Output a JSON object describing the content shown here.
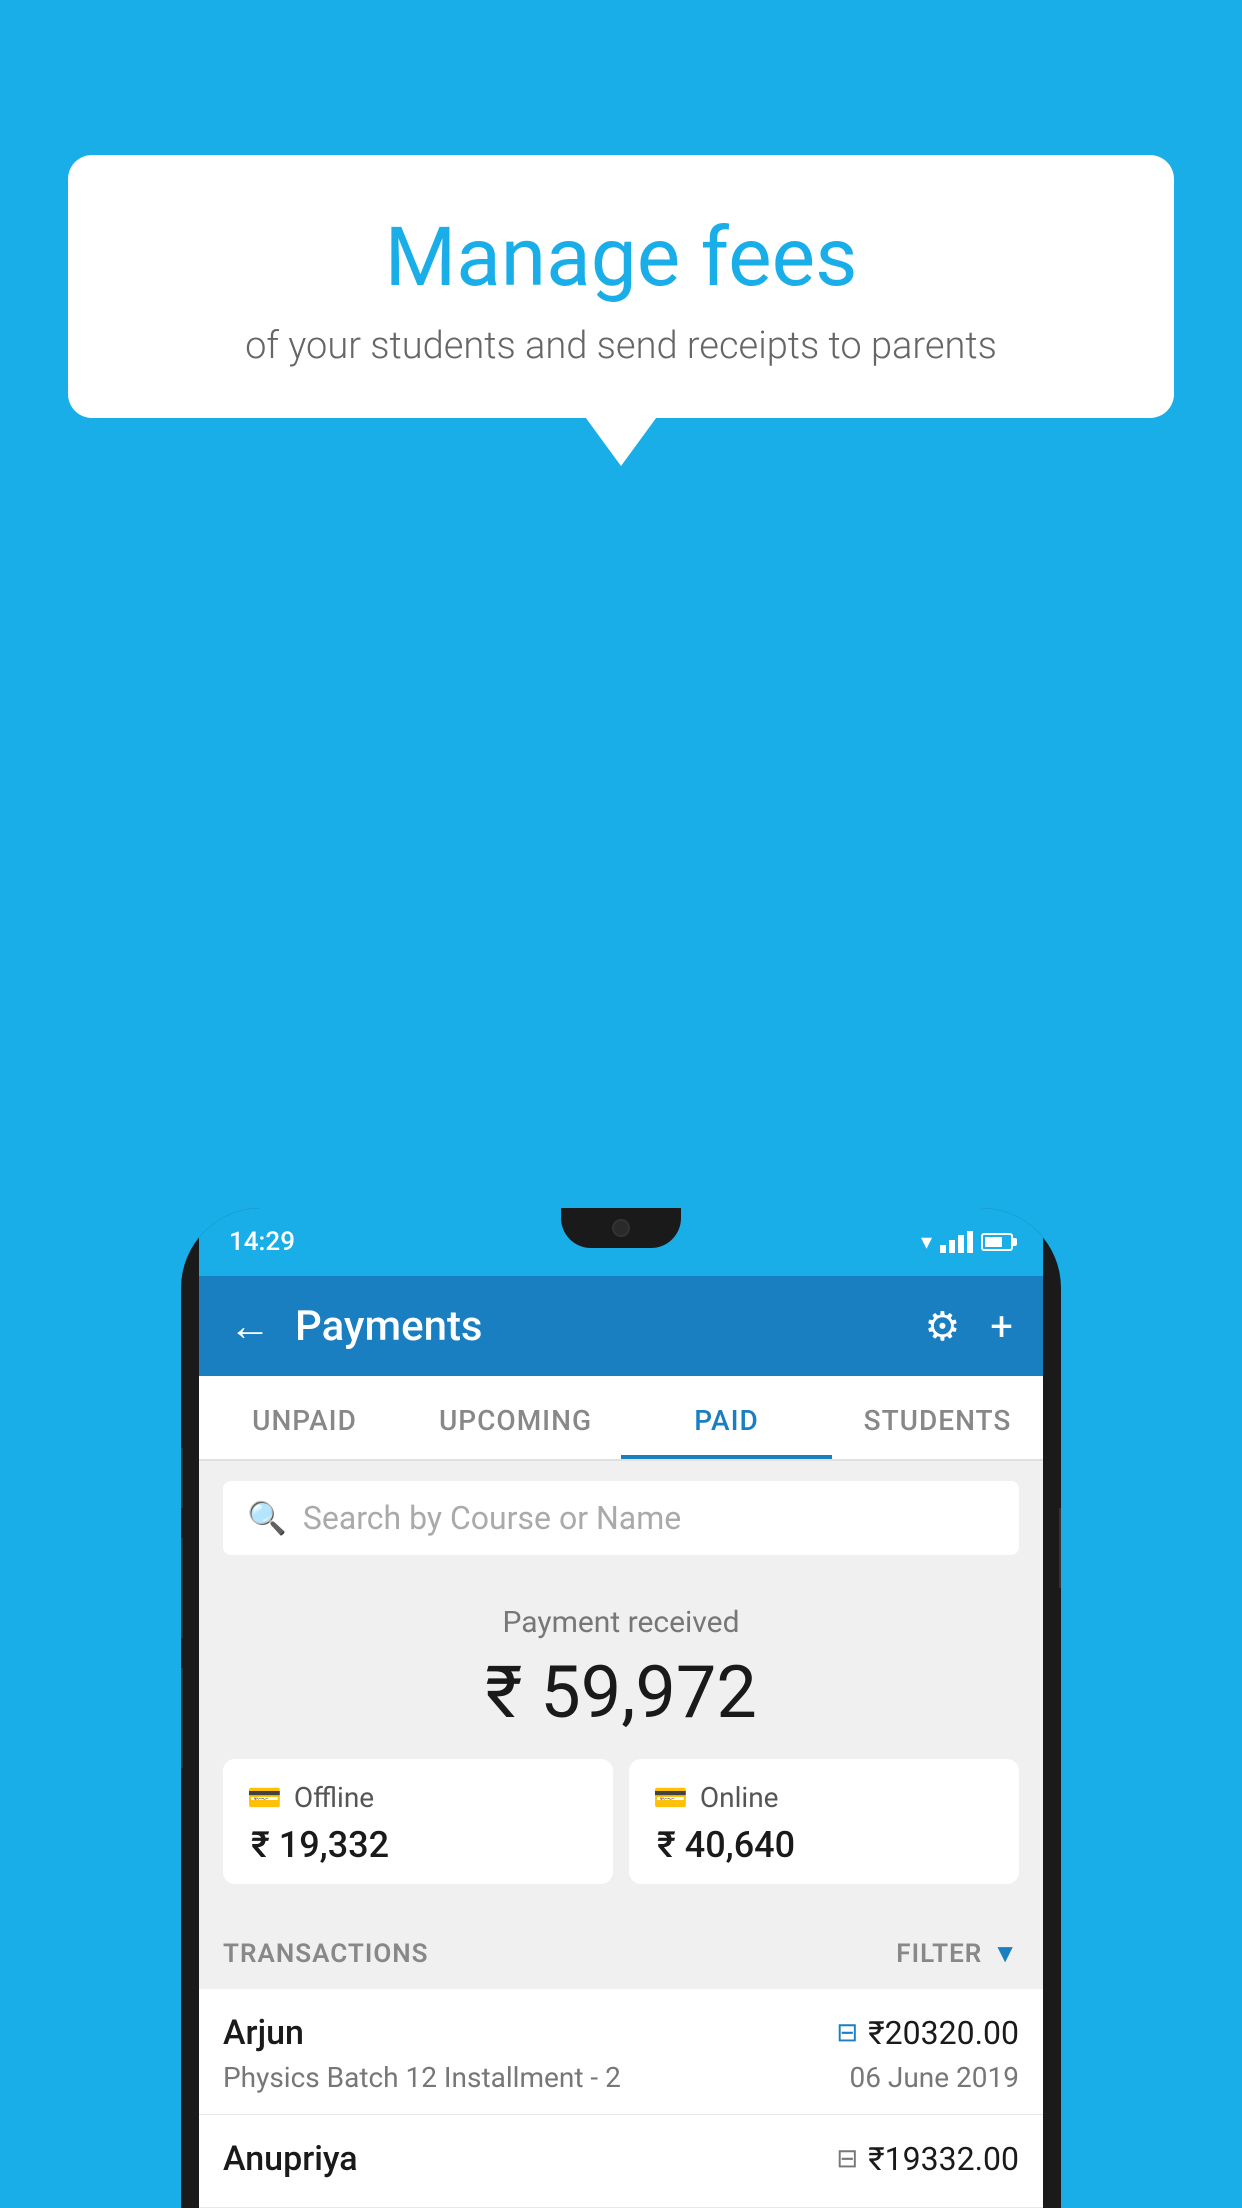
{
  "background_color": "#1aaee8",
  "speech_bubble": {
    "title": "Manage fees",
    "subtitle": "of your students and send receipts to parents"
  },
  "status_bar": {
    "time": "14:29"
  },
  "header": {
    "title": "Payments",
    "back_label": "←",
    "settings_icon": "gear",
    "add_icon": "+"
  },
  "tabs": [
    {
      "label": "UNPAID",
      "active": false
    },
    {
      "label": "UPCOMING",
      "active": false
    },
    {
      "label": "PAID",
      "active": true
    },
    {
      "label": "STUDENTS",
      "active": false
    }
  ],
  "search": {
    "placeholder": "Search by Course or Name"
  },
  "payment_summary": {
    "received_label": "Payment received",
    "total_amount": "₹ 59,972",
    "offline": {
      "label": "Offline",
      "amount": "₹ 19,332"
    },
    "online": {
      "label": "Online",
      "amount": "₹ 40,640"
    }
  },
  "transactions_section": {
    "label": "TRANSACTIONS",
    "filter_label": "FILTER"
  },
  "transactions": [
    {
      "name": "Arjun",
      "course": "Physics Batch 12 Installment - 2",
      "amount": "₹20320.00",
      "date": "06 June 2019",
      "type": "online"
    },
    {
      "name": "Anupriya",
      "course": "",
      "amount": "₹19332.00",
      "date": "",
      "type": "offline"
    }
  ]
}
